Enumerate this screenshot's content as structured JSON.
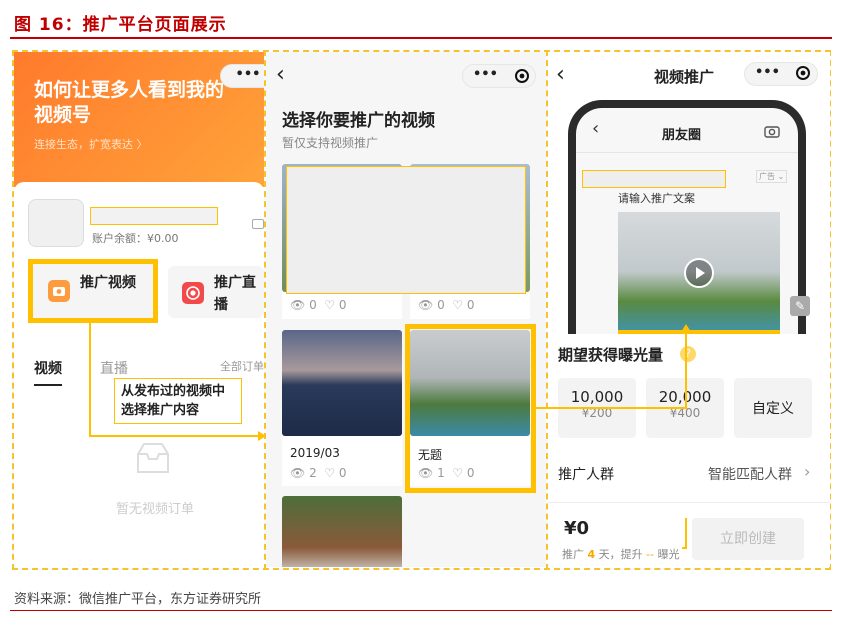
{
  "figure": {
    "title": "图 16：推广平台页面展示",
    "source": "资料来源：微信推广平台，东方证券研究所"
  },
  "panel1": {
    "menu_dots": "•••",
    "headline": "如何让更多人看到我的视频号",
    "subline": "连接生态，扩宽表达 〉",
    "balance": "账户余额：¥0.00",
    "promote_video": "推广视频",
    "promote_live": "推广直播",
    "tabs": [
      "视频",
      "直播",
      "全部订单"
    ],
    "empty_text": "暂无视频订单",
    "annotation": "从发布过的视频中选择推广内容"
  },
  "panel2": {
    "back_icon": "‹",
    "menu_dots": "•••",
    "heading": "选择你要推广的视频",
    "subheading": "暂仅支持视频推广",
    "videos": [
      {
        "title": "",
        "views": "0",
        "likes": "0"
      },
      {
        "title": "",
        "views": "0",
        "likes": "0"
      },
      {
        "title": "2019/03",
        "views": "2",
        "likes": "0"
      },
      {
        "title": "无题",
        "views": "1",
        "likes": "0"
      }
    ]
  },
  "panel3": {
    "back_icon": "‹",
    "title": "视频推广",
    "menu_dots": "•••",
    "phone_title": "朋友圈",
    "ad_tag": "广告 ⌄",
    "ad_copy_placeholder": "请输入推广文案",
    "exposure_heading": "期望获得曝光量",
    "options": [
      {
        "amount": "10,000",
        "price": "¥200"
      },
      {
        "amount": "20,000",
        "price": "¥400"
      },
      {
        "amount": "自定义",
        "price": ""
      }
    ],
    "audience_label": "推广人群",
    "audience_value": "智能匹配人群",
    "total": "¥0",
    "summary_pre": "推广",
    "summary_days": "4",
    "summary_mid": "天，提升",
    "summary_boost": "--",
    "summary_post": "曝光",
    "create_button": "立即创建"
  }
}
